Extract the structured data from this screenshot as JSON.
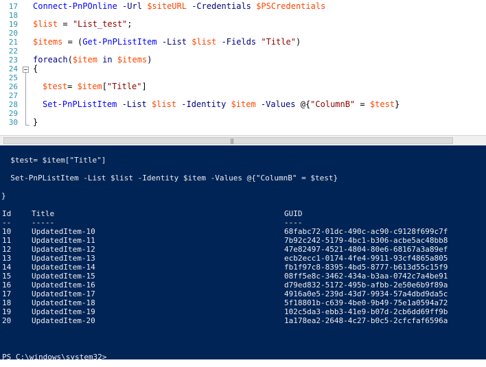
{
  "editor": {
    "lines": [
      {
        "num": "17"
      },
      {
        "num": "18"
      },
      {
        "num": "19"
      },
      {
        "num": "20"
      },
      {
        "num": "21"
      },
      {
        "num": "22"
      },
      {
        "num": "23"
      },
      {
        "num": "24"
      },
      {
        "num": "25"
      },
      {
        "num": "26"
      },
      {
        "num": "27"
      },
      {
        "num": "28"
      },
      {
        "num": "29"
      },
      {
        "num": "30"
      }
    ],
    "code": {
      "l17": {
        "cmd": "Connect-PnPOnline",
        "p1": " -Url ",
        "v1": "$siteURL",
        "p2": " -Credentials ",
        "v2": "$PSCredentials"
      },
      "l19": {
        "v1": "$list",
        "op": " = ",
        "str": "\"List_test\"",
        "end": ";"
      },
      "l21": {
        "v1": "$items",
        "op": " = (",
        "cmd": "Get-PnPListItem",
        "p1": " -List ",
        "v2": "$list",
        "p2": " -Fields ",
        "str": "\"Title\"",
        "end": ")"
      },
      "l23": {
        "kw": "foreach",
        "open": "(",
        "v1": "$item",
        "in": " in ",
        "v2": "$items",
        "close": ")"
      },
      "l24": {
        "brace": "{"
      },
      "l26": {
        "v1": "$test",
        "op": "= ",
        "v2": "$item",
        "idx_open": "[",
        "str": "\"Title\"",
        "idx_close": "]"
      },
      "l28": {
        "cmd": "Set-PnPListItem",
        "p1": " -List ",
        "v1": "$list",
        "p2": " -Identity ",
        "v2": "$item",
        "p3": " -Values ",
        "at": "@{",
        "str": "\"ColumnB\"",
        "eq": " = ",
        "v3": "$test",
        "end": "}"
      },
      "l30": {
        "brace": "}"
      }
    }
  },
  "scrollbar": {
    "grip": "|||"
  },
  "console": {
    "echo": [
      "  $test= $item[\"Title\"]",
      "  Set-PnPListItem -List $list -Identity $item -Values @{\"ColumnB\" = $test}",
      "}"
    ],
    "table": {
      "headers": {
        "id": "Id",
        "title": "Title",
        "guid": "GUID"
      },
      "underlines": {
        "id": "--",
        "title": "-----",
        "guid": "----"
      },
      "rows": [
        {
          "id": "10",
          "title": "UpdatedItem-10",
          "guid": "68fabc72-01dc-490c-ac90-c9128f699c7f"
        },
        {
          "id": "11",
          "title": "UpdatedItem-11",
          "guid": "7b92c242-5179-4bc1-b306-acbe5ac48bb8"
        },
        {
          "id": "12",
          "title": "UpdatedItem-12",
          "guid": "47e82497-4521-4804-80e6-68167a3a89ef"
        },
        {
          "id": "13",
          "title": "UpdatedItem-13",
          "guid": "ecb2ecc1-0174-4fe4-9911-93cf4865a805"
        },
        {
          "id": "14",
          "title": "UpdatedItem-14",
          "guid": "fb1f97c8-8395-4bd5-8777-b613d55c15f9"
        },
        {
          "id": "15",
          "title": "UpdatedItem-15",
          "guid": "08ff5e8c-3462-434a-b3aa-0742c7a4be91"
        },
        {
          "id": "16",
          "title": "UpdatedItem-16",
          "guid": "d79ed832-5172-495b-afbb-2e50e6b9f89a"
        },
        {
          "id": "17",
          "title": "UpdatedItem-17",
          "guid": "4916a0e5-239d-43d7-9934-57a4dbd9da5c"
        },
        {
          "id": "18",
          "title": "UpdatedItem-18",
          "guid": "5f18801b-c639-4be0-9b49-75e1a0594a72"
        },
        {
          "id": "19",
          "title": "UpdatedItem-19",
          "guid": "102c5da3-ebb3-41e9-b07d-2cb6dd69ff9b"
        },
        {
          "id": "20",
          "title": "UpdatedItem-20",
          "guid": "1a178ea2-2648-4c27-b0c5-2cfcfaf6596a"
        }
      ]
    },
    "prompt": "PS C:\\windows\\system32>"
  },
  "colors": {
    "console_bg": "#012456",
    "console_fg": "#eeedf0",
    "variable": "#ff4500",
    "string": "#8b0000",
    "command": "#0000ff",
    "parameter": "#000080",
    "line_number": "#2b91af"
  }
}
